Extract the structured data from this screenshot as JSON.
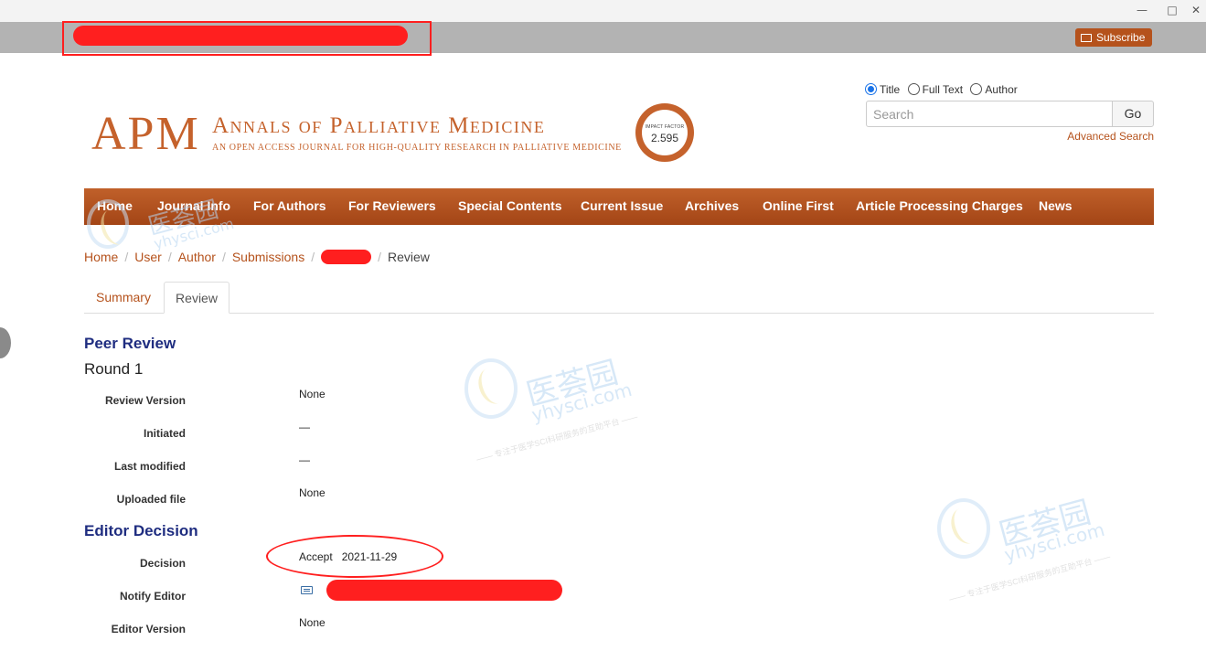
{
  "window": {
    "controls": [
      "—",
      "□",
      "✕"
    ]
  },
  "topbar": {
    "subscribe_label": "Subscribe"
  },
  "logo": {
    "abbr": "APM",
    "title": "Annals of Palliative Medicine",
    "subtitle": "An open access journal for high-quality research in palliative medicine",
    "badge_label": "IMPACT FACTOR",
    "badge_value": "2.595"
  },
  "search": {
    "options": [
      "Title",
      "Full Text",
      "Author"
    ],
    "selected": "Title",
    "placeholder": "Search",
    "go_label": "Go",
    "advanced_label": "Advanced Search"
  },
  "nav": {
    "items": [
      "Home",
      "Journal Info",
      "For Authors",
      "For Reviewers",
      "Special Contents",
      "Current Issue",
      "Archives",
      "Online First",
      "Article Processing Charges",
      "News"
    ]
  },
  "breadcrumb": {
    "items": [
      "Home",
      "User",
      "Author",
      "Submissions"
    ],
    "current": "Review"
  },
  "tabs": [
    "Summary",
    "Review"
  ],
  "peer_review": {
    "heading": "Peer Review",
    "round": "Round 1",
    "fields": [
      {
        "label": "Review Version",
        "value": "None"
      },
      {
        "label": "Initiated",
        "value": "—"
      },
      {
        "label": "Last modified",
        "value": "—"
      },
      {
        "label": "Uploaded file",
        "value": "None"
      }
    ]
  },
  "editor_decision": {
    "heading": "Editor Decision",
    "decision_label": "Decision",
    "decision_value": "Accept",
    "decision_date": "2021-11-29",
    "notify_label": "Notify Editor",
    "editor_version_label": "Editor Version",
    "editor_version_value": "None"
  },
  "watermark": {
    "cn": "医荟园",
    "en": "yhysci.com",
    "tagline": "—— 专注于医学SCI科研服务的互助平台 ——"
  },
  "colors": {
    "brand": "#c5622c",
    "nav_bg": "#b5521c",
    "heading": "#1f2d80",
    "redaction": "#ff1f1f"
  }
}
